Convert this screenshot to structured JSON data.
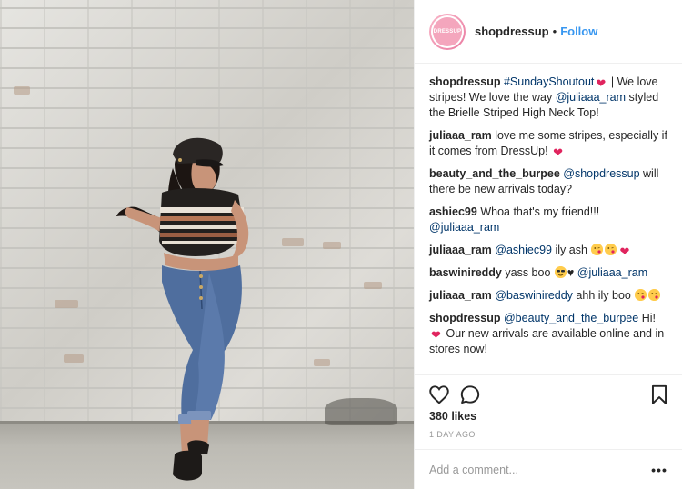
{
  "post": {
    "author": "shopdressup",
    "avatar_text": "DRESSUP",
    "separator": "•",
    "follow_label": "Follow",
    "photo_alt": "Woman in striped top, cap and jeans posing in front of a white brick wall",
    "comments": [
      {
        "user": "shopdressup",
        "parts": [
          {
            "t": "m",
            "v": "#SundayShoutout"
          },
          {
            "t": "e",
            "v": "heart"
          },
          {
            "t": "x",
            "v": " | We love stripes! We love the way "
          },
          {
            "t": "m",
            "v": "@juliaaa_ram"
          },
          {
            "t": "x",
            "v": " styled the Brielle Striped High Neck Top!"
          }
        ]
      },
      {
        "user": "juliaaa_ram",
        "parts": [
          {
            "t": "x",
            "v": "love me some stripes, especially if it comes from DressUp! "
          },
          {
            "t": "e",
            "v": "heart"
          }
        ]
      },
      {
        "user": "beauty_and_the_burpee",
        "parts": [
          {
            "t": "m",
            "v": "@shopdressup"
          },
          {
            "t": "x",
            "v": " will there be new arrivals today?"
          }
        ]
      },
      {
        "user": "ashiec99",
        "parts": [
          {
            "t": "x",
            "v": "Whoa that's my friend!!! "
          },
          {
            "t": "m",
            "v": "@juliaaa_ram"
          }
        ]
      },
      {
        "user": "juliaaa_ram",
        "parts": [
          {
            "t": "m",
            "v": "@ashiec99"
          },
          {
            "t": "x",
            "v": " ily ash "
          },
          {
            "t": "e",
            "v": "face"
          },
          {
            "t": "e",
            "v": "face"
          },
          {
            "t": "e",
            "v": "heart"
          }
        ]
      },
      {
        "user": "baswinireddy",
        "parts": [
          {
            "t": "x",
            "v": "yass boo "
          },
          {
            "t": "e",
            "v": "cool"
          },
          {
            "t": "x",
            "v": "♥ "
          },
          {
            "t": "m",
            "v": "@juliaaa_ram"
          }
        ]
      },
      {
        "user": "juliaaa_ram",
        "parts": [
          {
            "t": "m",
            "v": "@baswinireddy"
          },
          {
            "t": "x",
            "v": " ahh ily boo "
          },
          {
            "t": "e",
            "v": "face"
          },
          {
            "t": "e",
            "v": "face"
          }
        ]
      },
      {
        "user": "shopdressup",
        "parts": [
          {
            "t": "m",
            "v": "@beauty_and_the_burpee"
          },
          {
            "t": "x",
            "v": " Hi! "
          },
          {
            "t": "e",
            "v": "heart"
          },
          {
            "t": "x",
            "v": " Our new arrivals are available online and in stores now!"
          }
        ]
      }
    ],
    "likes_label": "380 likes",
    "time_label": "1 DAY AGO",
    "comment_placeholder": "Add a comment...",
    "more_label": "•••"
  },
  "icons": {
    "like": "heart-outline-icon",
    "comment": "speech-bubble-icon",
    "save": "bookmark-icon",
    "more": "ellipsis-icon"
  },
  "colors": {
    "accent": "#3897f0",
    "mention": "#003569",
    "text": "#262626",
    "muted": "#999999",
    "border": "#efefef",
    "heart": "#e0245e"
  }
}
